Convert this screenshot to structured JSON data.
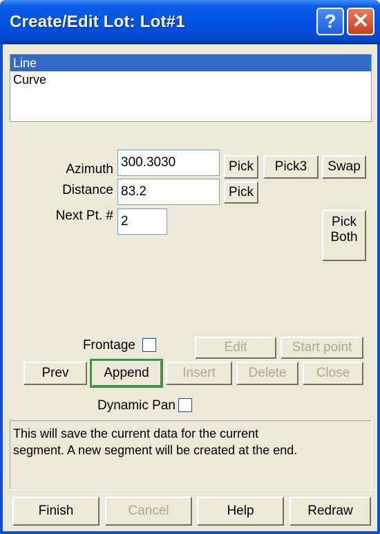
{
  "window": {
    "title": "Create/Edit Lot: Lot#1",
    "help_glyph": "?",
    "close_glyph": "✕"
  },
  "segment_list": {
    "items": [
      {
        "label": "Line",
        "selected": true
      },
      {
        "label": "Curve",
        "selected": false
      }
    ]
  },
  "fields": {
    "azimuth": {
      "label": "Azimuth",
      "value": "300.3030"
    },
    "distance": {
      "label": "Distance",
      "value": "83.2"
    },
    "next_pt": {
      "label": "Next Pt. #",
      "value": "2"
    }
  },
  "buttons": {
    "pick_azimuth": "Pick",
    "pick3": "Pick3",
    "swap": "Swap",
    "pick_distance": "Pick",
    "pick_both_line1": "Pick",
    "pick_both_line2": "Both",
    "edit": "Edit",
    "start_point": "Start point",
    "prev": "Prev",
    "append": "Append",
    "insert": "Insert",
    "delete": "Delete",
    "close": "Close",
    "finish": "Finish",
    "cancel": "Cancel",
    "help": "Help",
    "redraw": "Redraw"
  },
  "frontage": {
    "label": "Frontage",
    "checked": false
  },
  "dynamic_pan": {
    "label": "Dynamic Pan",
    "checked": false
  },
  "description": {
    "line1": "This will save the current data for the current",
    "line2": "segment. A new segment will be created at the end."
  }
}
